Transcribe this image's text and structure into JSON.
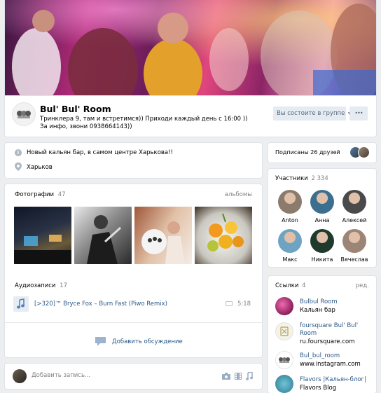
{
  "group": {
    "name": "Bul' Bul' Room",
    "status": "Тринклера 9, там и встретимся)) Приходи каждый день с 16:00 )) За инфо, звони 0938664143))",
    "member_button": "Вы состоите в группе",
    "more_button": "•••"
  },
  "info": {
    "description": "Новый кальян бар, в самом центре Харькова!!",
    "city": "Харьков"
  },
  "photos": {
    "title": "Фотографии",
    "count": "47",
    "albums_link": "альбомы"
  },
  "audio": {
    "title": "Аудиозаписи",
    "count": "17",
    "track": "[>320]™ Bryce Fox – Burn Fast (Piwo Remix)",
    "duration": "5:18"
  },
  "discussion": {
    "add_label": "Добавить обсуждение"
  },
  "post": {
    "placeholder": "Добавить запись..."
  },
  "friends": {
    "label": "Подписаны 26 друзей"
  },
  "members": {
    "title": "Участники",
    "count": "2 334",
    "items": [
      {
        "name": "Anton",
        "color": "#8a7b6c"
      },
      {
        "name": "Анна",
        "color": "#3c6e8f"
      },
      {
        "name": "Алексей",
        "color": "#4a4a4a"
      },
      {
        "name": "Макс",
        "color": "#6fa3c4"
      },
      {
        "name": "Никита",
        "color": "#1f3a2c"
      },
      {
        "name": "Вячеслав",
        "color": "#9c8576"
      }
    ]
  },
  "links": {
    "title": "Ссылки",
    "count": "4",
    "edit": "ред.",
    "items": [
      {
        "title": "Bulbul Room",
        "subtitle": "Кальян бар"
      },
      {
        "title": "foursquare Bul' Bul'",
        "title2": "Room",
        "subtitle": "ru.foursquare.com"
      },
      {
        "title": "Bul_bul_room",
        "subtitle": "www.instagram.com"
      },
      {
        "title": "Flavors |Кальян-блог|",
        "subtitle": "Flavors Blog"
      }
    ]
  }
}
